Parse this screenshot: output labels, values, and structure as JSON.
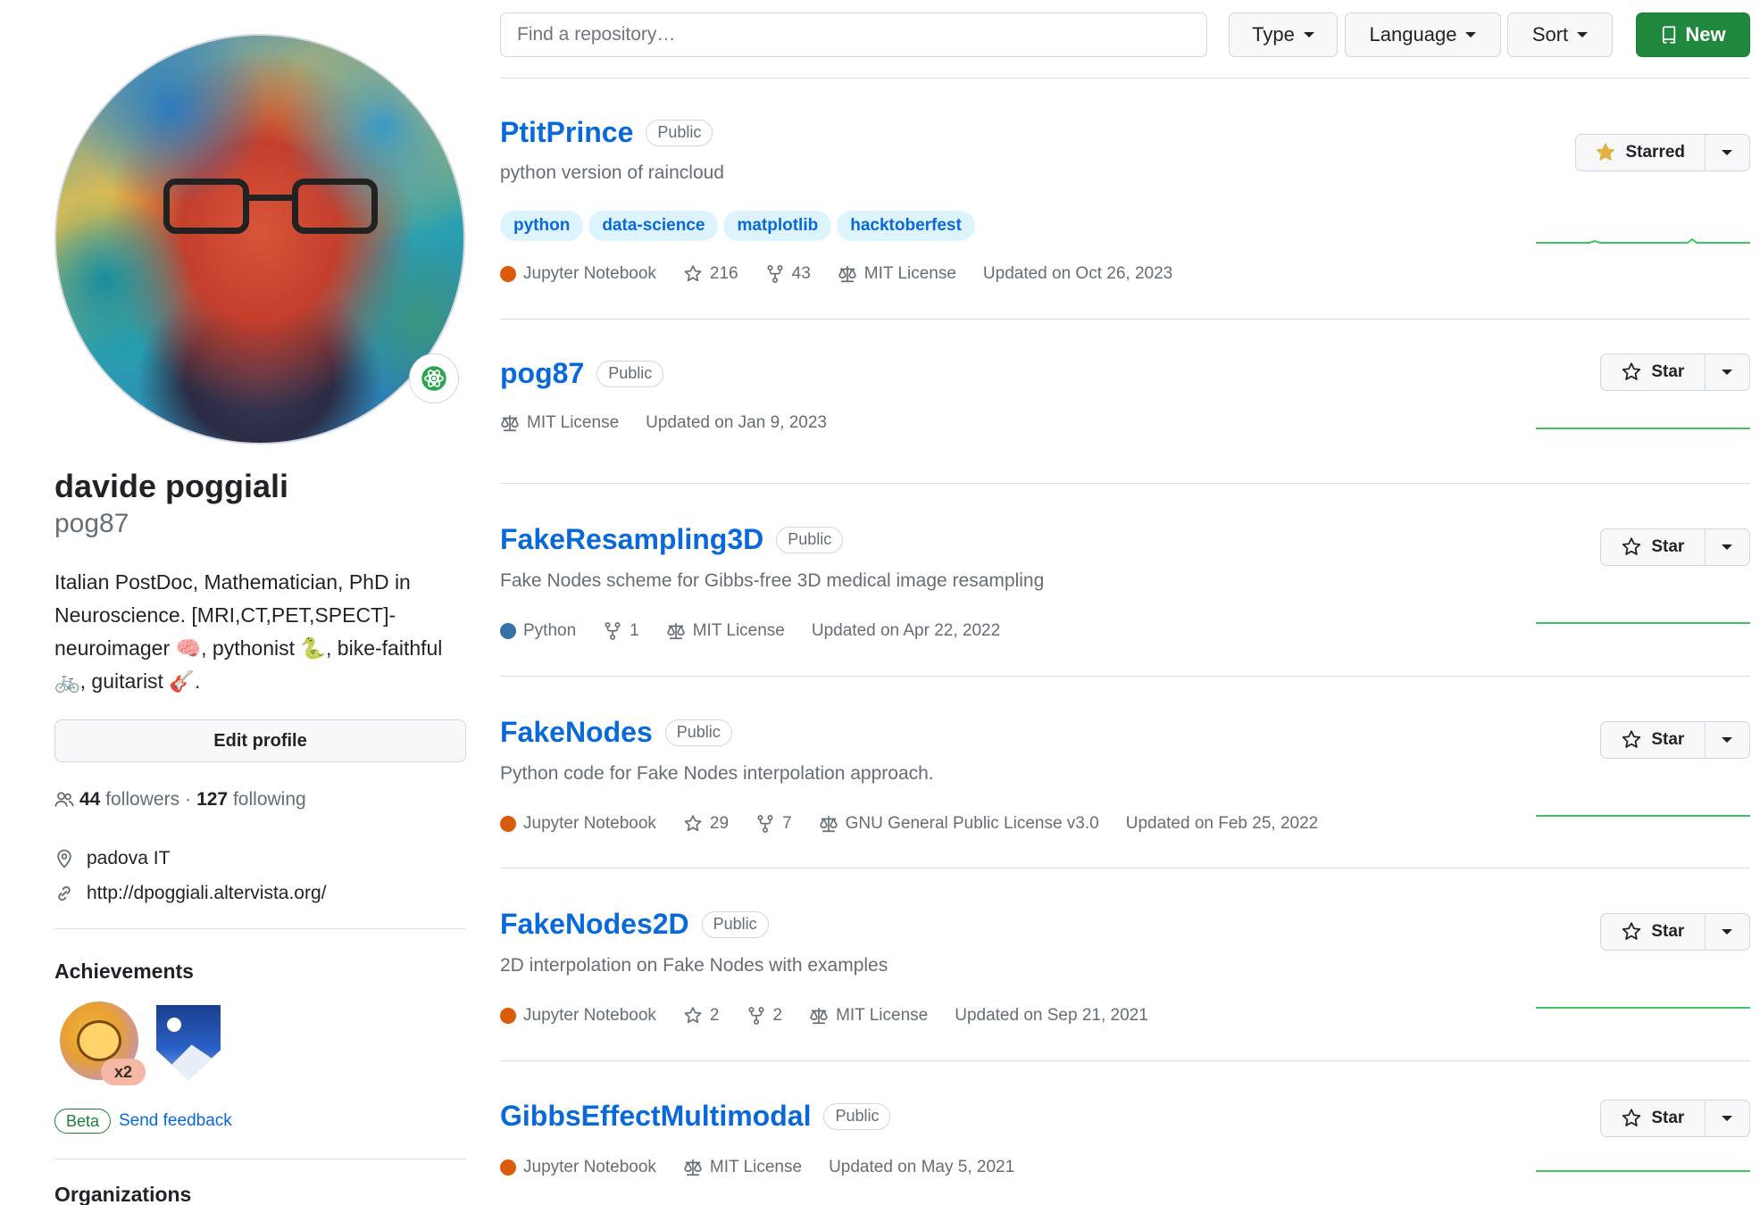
{
  "profile": {
    "name": "davide poggiali",
    "login": "pog87",
    "bio": "Italian PostDoc, Mathematician, PhD in Neuroscience. [MRI,CT,PET,SPECT]-neuroimager 🧠, pythonist 🐍, bike-faithful 🚲, guitarist 🎸.",
    "edit_label": "Edit profile",
    "followers_count": "44",
    "followers_label": "followers",
    "separator": "·",
    "following_count": "127",
    "following_label": "following",
    "location": "padova IT",
    "website": "http://dpoggiali.altervista.org/",
    "achievements_title": "Achievements",
    "achievement_count": "x2",
    "beta_label": "Beta",
    "feedback_label": "Send feedback",
    "organizations_title": "Organizations"
  },
  "toolbar": {
    "search_placeholder": "Find a repository…",
    "type_label": "Type",
    "language_label": "Language",
    "sort_label": "Sort",
    "new_label": "New"
  },
  "repos": [
    {
      "name": "PtitPrince",
      "visibility": "Public",
      "description": "python version of raincloud",
      "topics": [
        "python",
        "data-science",
        "matplotlib",
        "hacktoberfest"
      ],
      "language": "Jupyter Notebook",
      "stars": "216",
      "forks": "43",
      "license": "MIT License",
      "updated": "Updated on Oct 26, 2023",
      "star_label": "Starred"
    },
    {
      "name": "pog87",
      "visibility": "Public",
      "license": "MIT License",
      "updated": "Updated on Jan 9, 2023",
      "star_label": "Star"
    },
    {
      "name": "FakeResampling3D",
      "visibility": "Public",
      "description": "Fake Nodes scheme for Gibbs-free 3D medical image resampling",
      "language": "Python",
      "forks": "1",
      "license": "MIT License",
      "updated": "Updated on Apr 22, 2022",
      "star_label": "Star"
    },
    {
      "name": "FakeNodes",
      "visibility": "Public",
      "description": "Python code for Fake Nodes interpolation approach.",
      "language": "Jupyter Notebook",
      "stars": "29",
      "forks": "7",
      "license": "GNU General Public License v3.0",
      "updated": "Updated on Feb 25, 2022",
      "star_label": "Star"
    },
    {
      "name": "FakeNodes2D",
      "visibility": "Public",
      "description": "2D interpolation on Fake Nodes with examples",
      "language": "Jupyter Notebook",
      "stars": "2",
      "forks": "2",
      "license": "MIT License",
      "updated": "Updated on Sep 21, 2021",
      "star_label": "Star"
    },
    {
      "name": "GibbsEffectMultimodal",
      "visibility": "Public",
      "language": "Jupyter Notebook",
      "license": "MIT License",
      "updated": "Updated on May 5, 2021",
      "star_label": "Star"
    }
  ],
  "colors": {
    "link": "#0969da",
    "green": "#1f883d",
    "jupyter": "#DA5B0B",
    "python": "#3572A5",
    "star_gold": "#e3b341",
    "spark": "#40c463"
  },
  "icons": [
    "people-icon",
    "location-icon",
    "link-icon",
    "star-icon",
    "star-filled-icon",
    "fork-icon",
    "law-icon",
    "repo-icon",
    "caret-down-icon",
    "emoji-status-icon"
  ]
}
